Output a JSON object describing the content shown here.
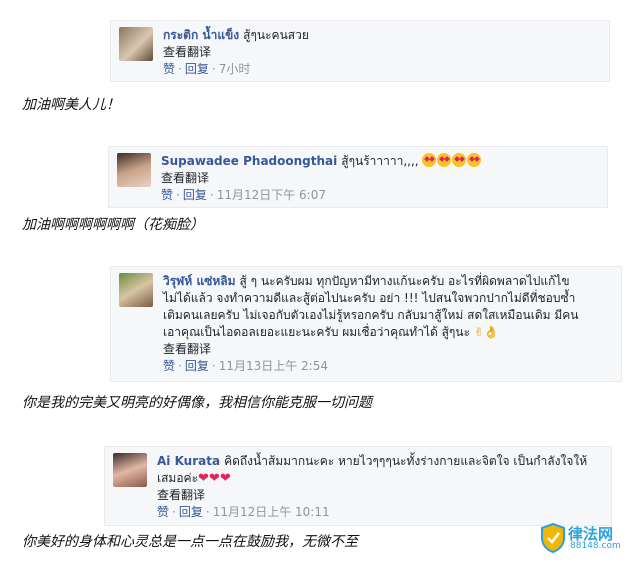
{
  "translate_label": "查看翻译",
  "like_label": "赞",
  "reply_label": "回复",
  "comments": [
    {
      "author": "กระติก น้ำแข็ง",
      "text": "สู้ๆนะคนสวย",
      "timestamp": "7小时",
      "caption": "加油啊美人儿！"
    },
    {
      "author": "Supawadee Phadoongthai",
      "text": "สู้ๆนร้าาาาา,,,,",
      "timestamp": "11月12日下午 6:07",
      "caption": "加油啊啊啊啊啊啊（花痴脸）"
    },
    {
      "author": "วิรุฬห์ แซ่หลิม",
      "text_lines": [
        "สู้ ๆ นะครับผม ทุกปัญหามีทางแก้นะครับ อะไรที่ผิดพลาดไปแก้ไข",
        "ไม่ได้แล้ว จงทำความดีและสู้ต่อไปนะครับ อย่า !!! ไปสนใจพวกปากไม่ดีที่ชอบซ้ำ",
        "เติมคนเลยครับ ไม่เจอกับตัวเองไม่รู้หรอกครับ กลับมาสู้ใหม่ สดใสเหมือนเดิม มีคน",
        "เอาคุณเป็นไอดอลเยอะแยะนะครับ ผมเชื่อว่าคุณทำได้ สู้ๆนะ"
      ],
      "timestamp": "11月13日上午 2:54",
      "caption": "你是我的完美又明亮的好偶像，我相信你能克服一切问题"
    },
    {
      "author": "Ai Kurata",
      "text_lines": [
        "คิดถึงน้ำส้มมากนะคะ หายไวๆๆๆนะทั้งร่างกายและจิตใจ เป็นกำลังใจให้",
        "เสมอค่ะ"
      ],
      "timestamp": "11月12日上午 10:11",
      "caption": "你美好的身体和心灵总是一点一点在鼓励我，无微不至"
    }
  ],
  "watermark": {
    "name": "律法网",
    "url": "88148.com"
  },
  "colors": {
    "author": "#365899",
    "timestamp": "#90949c",
    "card_bg": "#f6f7f9"
  }
}
